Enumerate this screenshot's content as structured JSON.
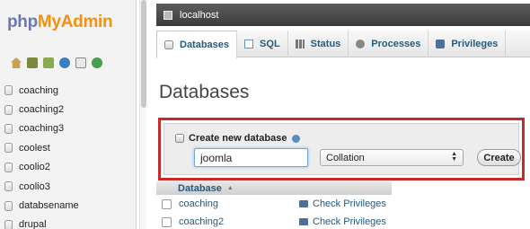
{
  "logo": {
    "php": "php",
    "my": "My",
    "admin": "Admin"
  },
  "sidebar": {
    "quick_icons": [
      "home-icon",
      "exit-icon",
      "query-window-icon",
      "help-icon",
      "docs-icon",
      "reload-icon"
    ],
    "databases": [
      "coaching",
      "coaching2",
      "coaching3",
      "coolest",
      "coolio2",
      "coolio3",
      "databsename",
      "drupal"
    ]
  },
  "server": {
    "label": "localhost"
  },
  "tabs": [
    {
      "label": "Databases",
      "icon": "database-icon",
      "active": true
    },
    {
      "label": "SQL",
      "icon": "sql-icon"
    },
    {
      "label": "Status",
      "icon": "status-icon"
    },
    {
      "label": "Processes",
      "icon": "processes-icon"
    },
    {
      "label": "Privileges",
      "icon": "privileges-icon"
    }
  ],
  "page_title": "Databases",
  "create_db": {
    "label": "Create new database",
    "name_value": "joomla",
    "collation": "Collation",
    "button": "Create"
  },
  "table": {
    "header": "Database",
    "rows": [
      {
        "name": "coaching",
        "action": "Check Privileges"
      },
      {
        "name": "coaching2",
        "action": "Check Privileges"
      }
    ]
  },
  "colors": {
    "highlight_border": "#c62a2a",
    "link": "#235a81"
  }
}
